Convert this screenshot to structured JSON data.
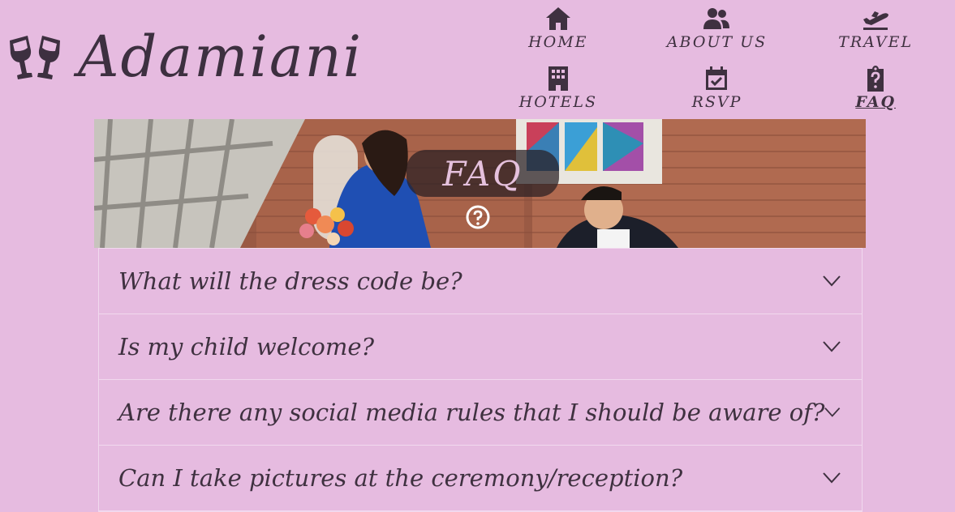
{
  "brand": {
    "name": "Adamiani",
    "icon": "glasses-cheers-icon"
  },
  "nav": [
    {
      "label": "HOME",
      "icon": "home-icon",
      "active": false
    },
    {
      "label": "ABOUT US",
      "icon": "users-icon",
      "active": false
    },
    {
      "label": "TRAVEL",
      "icon": "plane-departure-icon",
      "active": false
    },
    {
      "label": "HOTELS",
      "icon": "hotel-icon",
      "active": false
    },
    {
      "label": "RSVP",
      "icon": "calendar-check-icon",
      "active": false
    },
    {
      "label": "FAQ",
      "icon": "clipboard-question-icon",
      "active": true
    }
  ],
  "hero": {
    "title": "FAQ",
    "icon": "question-circle-icon"
  },
  "faq": {
    "questions": [
      "What will the dress code be?",
      "Is my child welcome?",
      "Are there any social media rules that I should be aware of?",
      "Can I take pictures at the ceremony/reception?"
    ]
  },
  "colors": {
    "background": "#e6bbe0",
    "text": "#3f3140",
    "hero_badge": "#2a1e23",
    "divider": "#f1d9ee"
  }
}
